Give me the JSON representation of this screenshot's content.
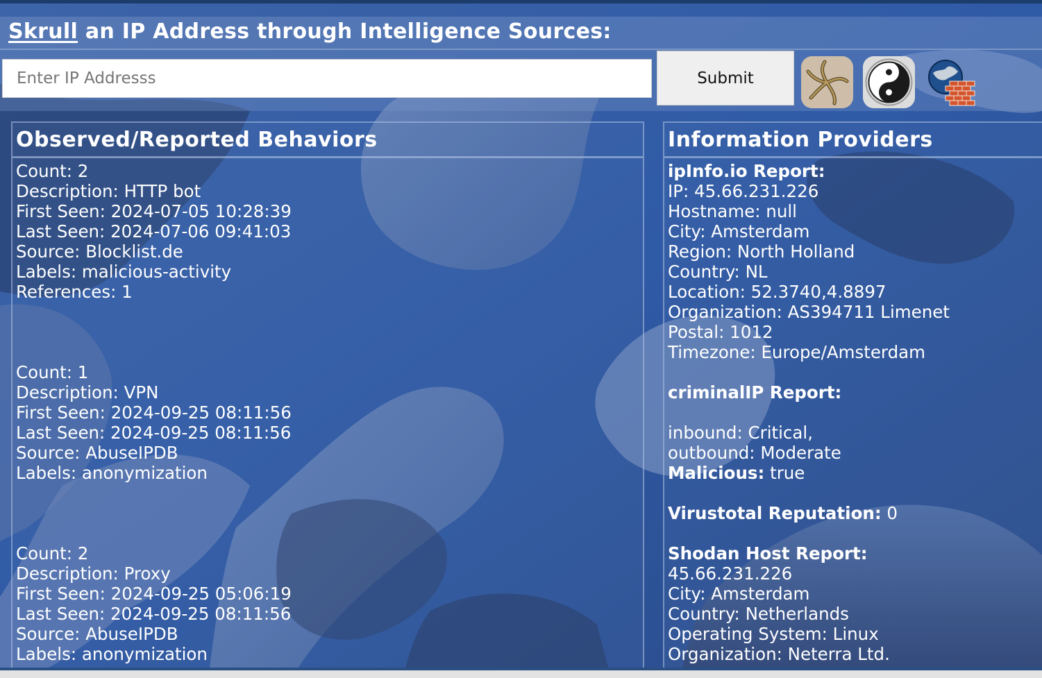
{
  "header": {
    "brand": "Skrull",
    "title_rest": " an IP Address through Intelligence Sources:"
  },
  "search": {
    "placeholder": "Enter IP Addresss",
    "value": "",
    "submit_label": "Submit"
  },
  "tools": [
    "starfish-icon",
    "yin-yang-icon",
    "globe-firewall-icon"
  ],
  "behaviors": {
    "title": "Observed/Reported Behaviors",
    "entries": [
      {
        "count": "Count: 2",
        "description": "Description: HTTP bot",
        "first_seen": "First Seen: 2024-07-05 10:28:39",
        "last_seen": "Last Seen: 2024-07-06 09:41:03",
        "source": "Source: Blocklist.de",
        "labels": "Labels: malicious-activity",
        "references": "References: 1"
      },
      {
        "count": "Count: 1",
        "description": "Description: VPN",
        "first_seen": "First Seen: 2024-09-25 08:11:56",
        "last_seen": "Last Seen: 2024-09-25 08:11:56",
        "source": "Source: AbuseIPDB",
        "labels": "Labels: anonymization"
      },
      {
        "count": "Count: 2",
        "description": "Description: Proxy",
        "first_seen": "First Seen: 2024-09-25 05:06:19",
        "last_seen": "Last Seen: 2024-09-25 08:11:56",
        "source": "Source: AbuseIPDB",
        "labels": "Labels: anonymization"
      }
    ]
  },
  "providers": {
    "title": "Information Providers",
    "ipinfo": {
      "heading": "ipInfo.io Report:",
      "ip": "IP: 45.66.231.226",
      "hostname": "Hostname: null",
      "city": "City: Amsterdam",
      "region": "Region: North Holland",
      "country": "Country: NL",
      "location": "Location: 52.3740,4.8897",
      "organization": "Organization: AS394711 Limenet",
      "postal": "Postal: 1012",
      "timezone": "Timezone: Europe/Amsterdam"
    },
    "criminalip": {
      "heading": "criminalIP Report:",
      "inbound": "inbound: Critical,",
      "outbound": "outbound: Moderate",
      "malicious_label": "Malicious:",
      "malicious_value": " true"
    },
    "virustotal": {
      "label": "Virustotal Reputation:",
      "value": " 0"
    },
    "shodan": {
      "heading": "Shodan Host Report:",
      "ip": "45.66.231.226",
      "city": "City: Amsterdam",
      "country": "Country: Netherlands",
      "os": "Operating System: Linux",
      "organization": "Organization: Neterra Ltd."
    }
  },
  "colors": {
    "background": "#3a5f9e",
    "text": "#ffffff",
    "topbar": "#1c3d6b"
  }
}
